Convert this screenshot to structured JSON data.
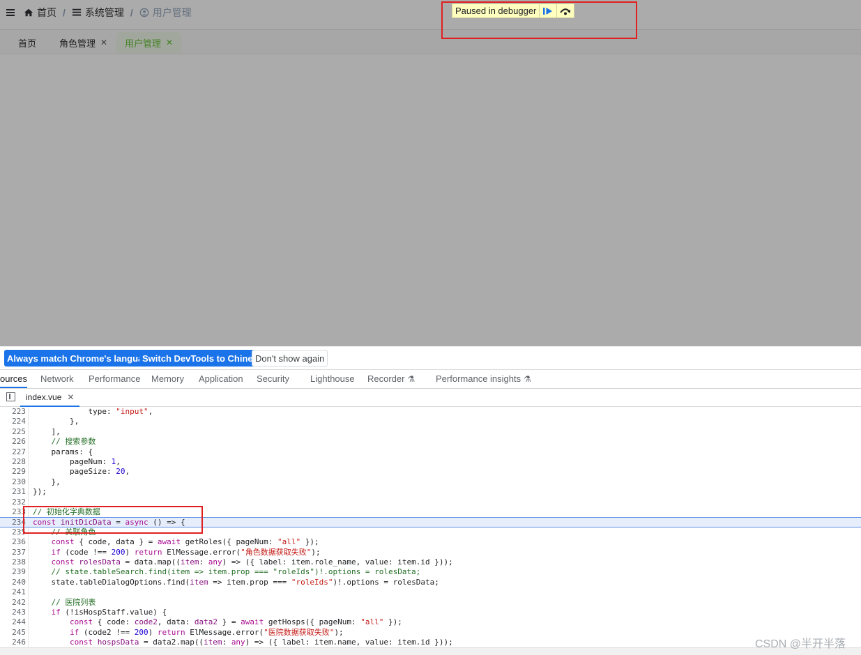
{
  "page": {
    "breadcrumb": [
      {
        "icon": "home-icon",
        "label": "首页"
      },
      {
        "icon": "menu-list-icon",
        "label": "系统管理"
      },
      {
        "icon": "user-circle-icon",
        "label": "用户管理"
      }
    ],
    "tags": [
      {
        "label": "首页",
        "closable": false,
        "active": false
      },
      {
        "label": "角色管理",
        "closable": true,
        "active": false
      },
      {
        "label": "用户管理",
        "closable": true,
        "active": true
      }
    ],
    "tag_close_glyph": "✕"
  },
  "debugger": {
    "paused_text": "Paused in debugger",
    "resume_icon": "resume-icon",
    "step_over_icon": "step-over-icon"
  },
  "devtools": {
    "infobar": {
      "match_language": "Always match Chrome's language",
      "switch_chinese": "Switch DevTools to Chinese",
      "dont_show": "Don't show again"
    },
    "tabs": [
      {
        "label": "ources",
        "active": true
      },
      {
        "label": "Network"
      },
      {
        "label": "Performance"
      },
      {
        "label": "Memory"
      },
      {
        "label": "Application"
      },
      {
        "label": "Security"
      },
      {
        "label": "Lighthouse"
      },
      {
        "label": "Recorder",
        "flask": true
      },
      {
        "label": "Performance insights",
        "flask": true
      }
    ],
    "file_tab": {
      "name": "index.vue",
      "close": "✕"
    },
    "code_lines": [
      {
        "n": "223",
        "html": "            type: <span class=\"str\">\"input\"</span>,"
      },
      {
        "n": "224",
        "html": "        },"
      },
      {
        "n": "225",
        "html": "    ],"
      },
      {
        "n": "226",
        "html": "    <span class=\"cm\">// 搜索参数</span>"
      },
      {
        "n": "227",
        "html": "    params: {"
      },
      {
        "n": "228",
        "html": "        pageNum: <span class=\"num\">1</span>,"
      },
      {
        "n": "229",
        "html": "        pageSize: <span class=\"num\">20</span>,"
      },
      {
        "n": "230",
        "html": "    },"
      },
      {
        "n": "231",
        "html": "});"
      },
      {
        "n": "232",
        "html": ""
      },
      {
        "n": "233",
        "html": "<span class=\"cm\">// 初始化字典数据</span>"
      },
      {
        "n": "234",
        "html": "<span class=\"kw\">const</span> <span class=\"var\">initDicData</span> = <span class=\"kw\">async</span> () => {",
        "exec": true
      },
      {
        "n": "235",
        "html": "    <span class=\"cm\">// 关联角色</span>"
      },
      {
        "n": "236",
        "html": "    <span class=\"kw\">const</span> { code, data } = <span class=\"kw\">await</span> getRoles({ pageNum: <span class=\"str\">\"all\"</span> });"
      },
      {
        "n": "237",
        "html": "    <span class=\"kw\">if</span> (code !== <span class=\"num\">200</span>) <span class=\"kw\">return</span> ElMessage.error(<span class=\"str\">\"角色数据获取失败\"</span>);"
      },
      {
        "n": "238",
        "html": "    <span class=\"kw\">const</span> <span class=\"var\">rolesData</span> = data.map((<span class=\"var\">item</span>: <span class=\"kw\">any</span>) => ({ label: item.role_name, value: item.id }));"
      },
      {
        "n": "239",
        "html": "    <span class=\"cm\">// state.tableSearch.find(item => item.prop === \"roleIds\")!.options = rolesData;</span>"
      },
      {
        "n": "240",
        "html": "    state.tableDialogOptions.find(<span class=\"var\">item</span> => item.prop === <span class=\"str\">\"roleIds\"</span>)!.options = rolesData;"
      },
      {
        "n": "241",
        "html": ""
      },
      {
        "n": "242",
        "html": "    <span class=\"cm\">// 医院列表</span>"
      },
      {
        "n": "243",
        "html": "    <span class=\"kw\">if</span> (!isHospStaff.value) {"
      },
      {
        "n": "244",
        "html": "        <span class=\"kw\">const</span> { code: <span class=\"var\">code2</span>, data: <span class=\"var\">data2</span> } = <span class=\"kw\">await</span> getHosps({ pageNum: <span class=\"str\">\"all\"</span> });"
      },
      {
        "n": "245",
        "html": "        <span class=\"kw\">if</span> (code2 !== <span class=\"num\">200</span>) <span class=\"kw\">return</span> ElMessage.error(<span class=\"str\">\"医院数据获取失败\"</span>);"
      },
      {
        "n": "246",
        "html": "        <span class=\"kw\">const</span> <span class=\"var\">hospsData</span> = data2.map((<span class=\"var\">item</span>: <span class=\"kw\">any</span>) => ({ label: item.name, value: item.id }));"
      }
    ]
  },
  "watermark": "CSDN @半开半落"
}
